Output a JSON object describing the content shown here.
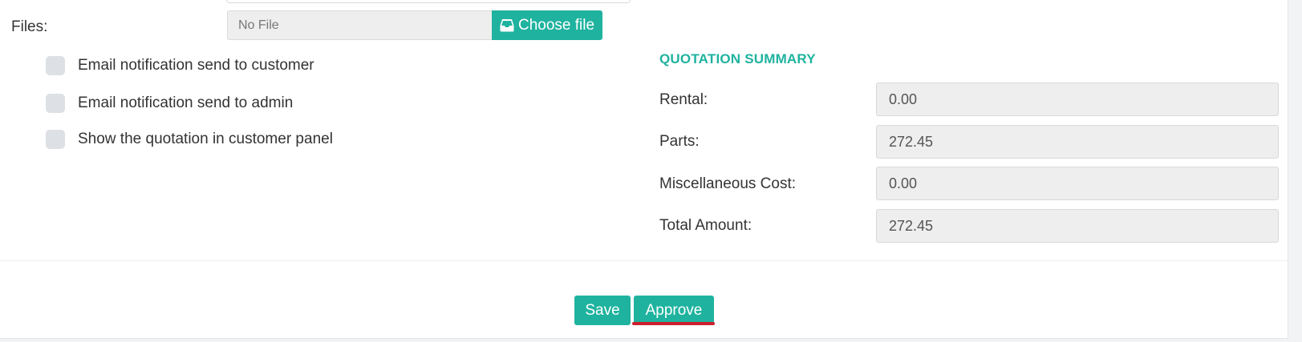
{
  "form": {
    "files_label": "Files:",
    "file_display": "No File",
    "choose_file_label": "Choose file",
    "choose_file_icon": "inbox-tray-icon"
  },
  "notifications": [
    {
      "label": "Email notification send to customer",
      "checked": false
    },
    {
      "label": "Email notification send to admin",
      "checked": false
    },
    {
      "label": "Show the quotation in customer panel",
      "checked": false
    }
  ],
  "summary": {
    "title": "QUOTATION SUMMARY",
    "rows": [
      {
        "label": "Rental:",
        "value": "0.00"
      },
      {
        "label": "Parts:",
        "value": "272.45"
      },
      {
        "label": "Miscellaneous Cost:",
        "value": "0.00"
      },
      {
        "label": "Total Amount:",
        "value": "272.45"
      }
    ]
  },
  "actions": {
    "save_label": "Save",
    "approve_label": "Approve"
  },
  "colors": {
    "accent": "#1fb39f",
    "checkbox": "#dde0e4",
    "readonly_field": "#eeeeee",
    "highlight_underline": "#cc1f2c"
  }
}
